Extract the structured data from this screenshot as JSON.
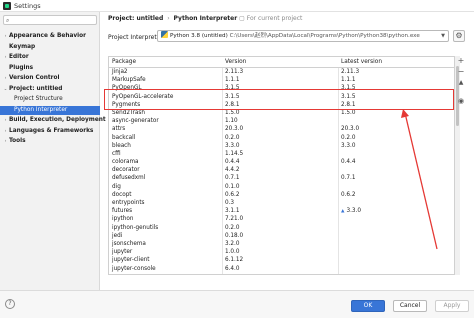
{
  "window": {
    "title": "Settings"
  },
  "sidebar": {
    "items": [
      {
        "label": "Appearance & Behavior",
        "arrow": "›",
        "bold": true,
        "selected": false,
        "indent": 0
      },
      {
        "label": "Keymap",
        "arrow": "",
        "bold": true,
        "selected": false,
        "indent": 0
      },
      {
        "label": "Editor",
        "arrow": "›",
        "bold": true,
        "selected": false,
        "indent": 0
      },
      {
        "label": "Plugins",
        "arrow": "",
        "bold": true,
        "selected": false,
        "indent": 0
      },
      {
        "label": "Version Control",
        "arrow": "›",
        "bold": true,
        "selected": false,
        "indent": 0
      },
      {
        "label": "Project: untitled",
        "arrow": "⌄",
        "bold": true,
        "selected": false,
        "indent": 0
      },
      {
        "label": "Project Structure",
        "arrow": "",
        "bold": false,
        "selected": false,
        "indent": 1
      },
      {
        "label": "Python Interpreter",
        "arrow": "",
        "bold": false,
        "selected": true,
        "indent": 1
      },
      {
        "label": "Build, Execution, Deployment",
        "arrow": "›",
        "bold": true,
        "selected": false,
        "indent": 0
      },
      {
        "label": "Languages & Frameworks",
        "arrow": "›",
        "bold": true,
        "selected": false,
        "indent": 0
      },
      {
        "label": "Tools",
        "arrow": "›",
        "bold": true,
        "selected": false,
        "indent": 0
      }
    ]
  },
  "breadcrumb": {
    "project": "Project: untitled",
    "separator": "›",
    "page": "Python Interpreter",
    "scope": "For current project"
  },
  "interpreter": {
    "label": "Project Interpreter:",
    "name": "Python 3.8 (untitled)",
    "path": "C:\\Users\\赵烈\\AppData\\Local\\Programs\\Python\\Python38\\python.exe"
  },
  "table": {
    "headers": [
      "Package",
      "Version",
      "Latest version"
    ],
    "rows": [
      [
        "Jinja2",
        "2.11.3",
        "2.11.3",
        false
      ],
      [
        "MarkupSafe",
        "1.1.1",
        "1.1.1",
        false
      ],
      [
        "PyOpenGL",
        "3.1.5",
        "3.1.5",
        false
      ],
      [
        "PyOpenGL-accelerate",
        "3.1.5",
        "3.1.5",
        false
      ],
      [
        "Pygments",
        "2.8.1",
        "2.8.1",
        false
      ],
      [
        "Send2Trash",
        "1.5.0",
        "1.5.0",
        false
      ],
      [
        "async-generator",
        "1.10",
        "",
        false
      ],
      [
        "attrs",
        "20.3.0",
        "20.3.0",
        false
      ],
      [
        "backcall",
        "0.2.0",
        "0.2.0",
        false
      ],
      [
        "bleach",
        "3.3.0",
        "3.3.0",
        false
      ],
      [
        "cffi",
        "1.14.5",
        "",
        false
      ],
      [
        "colorama",
        "0.4.4",
        "0.4.4",
        false
      ],
      [
        "decorator",
        "4.4.2",
        "",
        false
      ],
      [
        "defusedxml",
        "0.7.1",
        "0.7.1",
        false
      ],
      [
        "dig",
        "0.1.0",
        "",
        false
      ],
      [
        "docopt",
        "0.6.2",
        "0.6.2",
        false
      ],
      [
        "entrypoints",
        "0.3",
        "",
        false
      ],
      [
        "futures",
        "3.1.1",
        "3.3.0",
        true
      ],
      [
        "ipython",
        "7.21.0",
        "",
        false
      ],
      [
        "ipython-genutils",
        "0.2.0",
        "",
        false
      ],
      [
        "jedi",
        "0.18.0",
        "",
        false
      ],
      [
        "jsonschema",
        "3.2.0",
        "",
        false
      ],
      [
        "jupyter",
        "1.0.0",
        "",
        false
      ],
      [
        "jupyter-client",
        "6.1.12",
        "",
        false
      ],
      [
        "jupyter-console",
        "6.4.0",
        "",
        false
      ]
    ],
    "upgrade_symbol": "▲"
  },
  "tools": {
    "add": "+",
    "remove": "−",
    "upgrade": "▲",
    "eye": "◉"
  },
  "footer": {
    "help": "?",
    "ok": "OK",
    "cancel": "Cancel",
    "apply": "Apply"
  },
  "colors": {
    "accent": "#3875d7",
    "annotation": "#e53935"
  }
}
